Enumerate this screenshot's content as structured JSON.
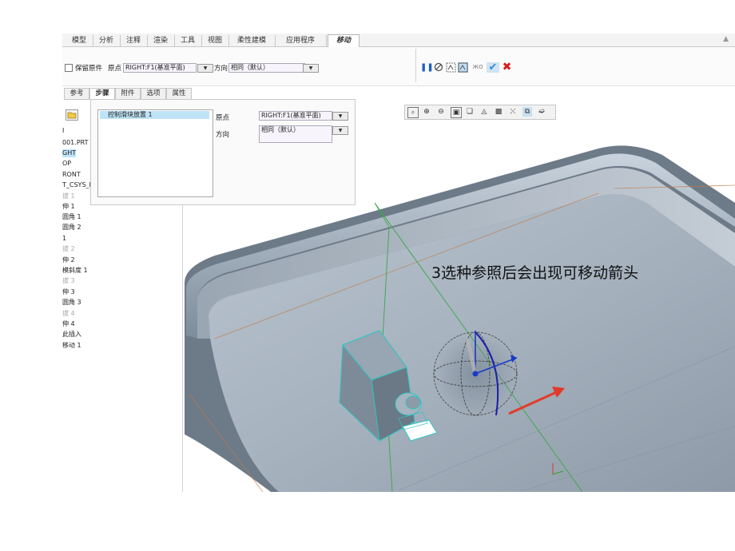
{
  "ribbon": {
    "tabs": [
      {
        "label": "模型"
      },
      {
        "label": "分析"
      },
      {
        "label": "注释"
      },
      {
        "label": "渲染"
      },
      {
        "label": "工具"
      },
      {
        "label": "视图"
      },
      {
        "label": "柔性建模"
      },
      {
        "label": "应用程序"
      },
      {
        "label": "移动"
      }
    ]
  },
  "dashboard": {
    "keep_original_label": "保留原件",
    "origin_label": "原点",
    "origin_value": "RIGHT:F1(基准平面)",
    "direction_label": "方向",
    "direction_value": "相同（默认）"
  },
  "subtabs": [
    {
      "label": "参考"
    },
    {
      "label": "步骤"
    },
    {
      "label": "附件"
    },
    {
      "label": "选项"
    },
    {
      "label": "属性"
    }
  ],
  "panel": {
    "collector_item": "控制滑块放置 1",
    "origin_label": "原点",
    "origin_value": "RIGHT:F1(基准平面)",
    "direction_label": "方向",
    "direction_value": "相同（默认）"
  },
  "tree": {
    "items": [
      {
        "label": "I"
      },
      {
        "label": "001.PRT"
      },
      {
        "label": "GHT"
      },
      {
        "label": "OP"
      },
      {
        "label": "RONT"
      },
      {
        "label": "T_CSYS_D"
      },
      {
        "label": "拔 1"
      },
      {
        "label": "伸 1"
      },
      {
        "label": "圆角 1"
      },
      {
        "label": "圆角 2"
      },
      {
        "label": "1"
      },
      {
        "label": "拔 2"
      },
      {
        "label": "伸 2"
      },
      {
        "label": "模斜度 1"
      },
      {
        "label": "拔 3"
      },
      {
        "label": "伸 3"
      },
      {
        "label": "圆角 3"
      },
      {
        "label": "拔 4"
      },
      {
        "label": "伸 4"
      },
      {
        "label": "此插入"
      },
      {
        "label": "移动 1"
      }
    ]
  },
  "annotation": "3选种参照后会出现可移动箭头",
  "colors": {
    "accent": "#1e88c8",
    "confirm": "#2f8fd8",
    "cancel": "#d32020",
    "arrow": "#e23a2a"
  },
  "icons": [
    "pause-icon",
    "stop-icon",
    "preview-icon",
    "verify-icon",
    "glasses-icon",
    "check-icon",
    "close-icon"
  ]
}
